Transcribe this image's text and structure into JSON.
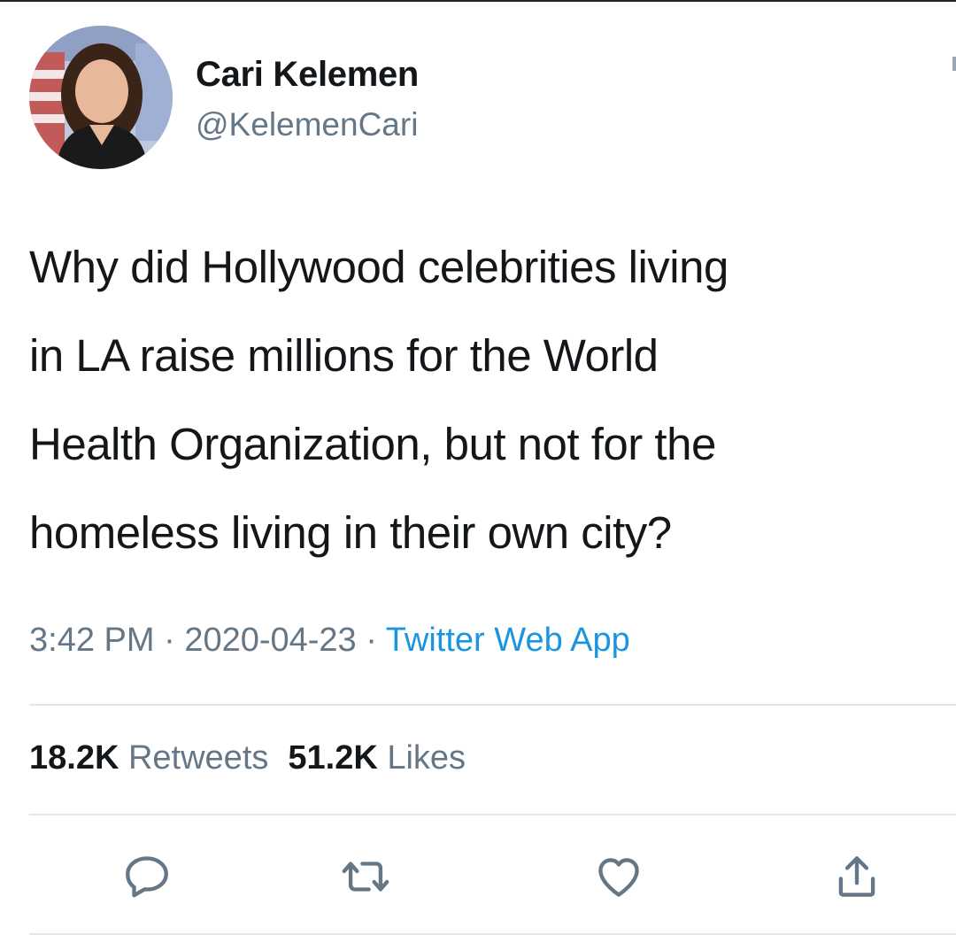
{
  "user": {
    "display_name": "Cari Kelemen",
    "handle": "@KelemenCari"
  },
  "tweet": {
    "lines": [
      "Why did Hollywood celebrities living",
      "in LA raise millions for the World",
      "Health Organization, but not for the",
      "homeless living in their own city?"
    ],
    "time": "3:42 PM",
    "separator": "·",
    "date": "2020-04-23",
    "source": "Twitter Web App"
  },
  "stats": {
    "retweets_count": "18.2K",
    "retweets_label": "Retweets",
    "likes_count": "51.2K",
    "likes_label": "Likes"
  },
  "actions": {
    "icons": [
      "reply-icon",
      "retweet-icon",
      "like-icon",
      "share-icon"
    ],
    "icon_color": "#657786"
  },
  "colors": {
    "text": "#14171a",
    "secondary": "#657786",
    "link": "#1b95e0",
    "divider": "#e1e8ed"
  }
}
